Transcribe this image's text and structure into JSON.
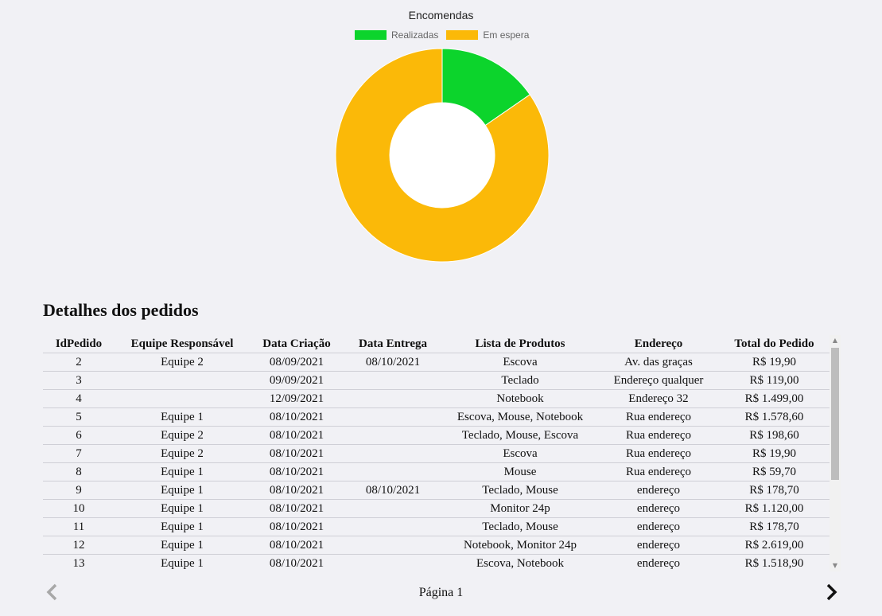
{
  "chart_data": {
    "type": "pie",
    "title": "Encomendas",
    "donut": true,
    "legend_position": "top",
    "series": [
      {
        "name": "Realizadas",
        "value": 2,
        "color": "#0cd42c"
      },
      {
        "name": "Em espera",
        "value": 11,
        "color": "#fbb908"
      }
    ]
  },
  "details": {
    "title": "Detalhes dos pedidos",
    "columns": [
      "IdPedido",
      "Equipe Responsável",
      "Data Criação",
      "Data Entrega",
      "Lista de Produtos",
      "Endereço",
      "Total do Pedido"
    ],
    "rows": [
      [
        "2",
        "Equipe 2",
        "08/09/2021",
        "08/10/2021",
        "Escova",
        "Av. das graças",
        "R$ 19,90"
      ],
      [
        "3",
        "",
        "09/09/2021",
        "",
        "Teclado",
        "Endereço qualquer",
        "R$ 119,00"
      ],
      [
        "4",
        "",
        "12/09/2021",
        "",
        "Notebook",
        "Endereço 32",
        "R$ 1.499,00"
      ],
      [
        "5",
        "Equipe 1",
        "08/10/2021",
        "",
        "Escova, Mouse, Notebook",
        "Rua endereço",
        "R$ 1.578,60"
      ],
      [
        "6",
        "Equipe 2",
        "08/10/2021",
        "",
        "Teclado, Mouse, Escova",
        "Rua endereço",
        "R$ 198,60"
      ],
      [
        "7",
        "Equipe 2",
        "08/10/2021",
        "",
        "Escova",
        "Rua endereço",
        "R$ 19,90"
      ],
      [
        "8",
        "Equipe 1",
        "08/10/2021",
        "",
        "Mouse",
        "Rua endereço",
        "R$ 59,70"
      ],
      [
        "9",
        "Equipe 1",
        "08/10/2021",
        "08/10/2021",
        "Teclado, Mouse",
        "endereço",
        "R$ 178,70"
      ],
      [
        "10",
        "Equipe 1",
        "08/10/2021",
        "",
        "Monitor 24p",
        "endereço",
        "R$ 1.120,00"
      ],
      [
        "11",
        "Equipe 1",
        "08/10/2021",
        "",
        "Teclado, Mouse",
        "endereço",
        "R$ 178,70"
      ],
      [
        "12",
        "Equipe 1",
        "08/10/2021",
        "",
        "Notebook, Monitor 24p",
        "endereço",
        "R$ 2.619,00"
      ],
      [
        "13",
        "Equipe 1",
        "08/10/2021",
        "",
        "Escova, Notebook",
        "endereço",
        "R$ 1.518,90"
      ]
    ]
  },
  "pagination": {
    "label": "Página 1",
    "prev_icon": "chevron-left-icon",
    "next_icon": "chevron-right-icon"
  }
}
